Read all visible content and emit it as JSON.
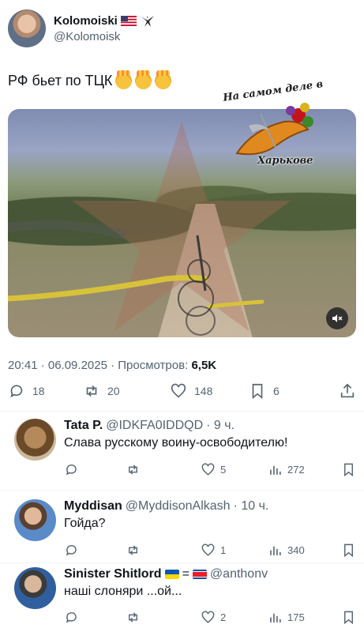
{
  "post": {
    "author_name": "Kolomoiski",
    "author_flag": "us-flag-icon",
    "author_badge": "eagle-icon",
    "author_handle": "@Kolomoisk",
    "text": "РФ бьет по ТЦК",
    "emoji": [
      "exploding-head",
      "exploding-head",
      "exploding-head"
    ],
    "overlay_top": "На самом деле в",
    "overlay_bottom": "Харькове",
    "time": "20:41 · 06.09.2025 · Просмотров:",
    "views": "6,5K",
    "replies": "18",
    "reposts": "20",
    "likes": "148",
    "bookmarks": "6"
  },
  "replies": [
    {
      "name": "Tata P.",
      "handle": "@IDKFA0IDDQD",
      "time": "· 9 ч.",
      "text": "Слава русскому воину-освободителю!",
      "likes": "5",
      "views": "272"
    },
    {
      "name": "Myddisan",
      "handle": "@MyddisonAlkash",
      "time": "· 10 ч.",
      "text": "Гойда?",
      "likes": "1",
      "views": "340"
    },
    {
      "name": "Sinister Shitlord",
      "eq": "=",
      "handle": "@anthonv",
      "text": "наші слоняри ...ой...",
      "likes": "2",
      "views": "175"
    }
  ],
  "colors": {
    "accent": "#1d9bf0",
    "muted": "#536471",
    "text": "#0f1419"
  }
}
